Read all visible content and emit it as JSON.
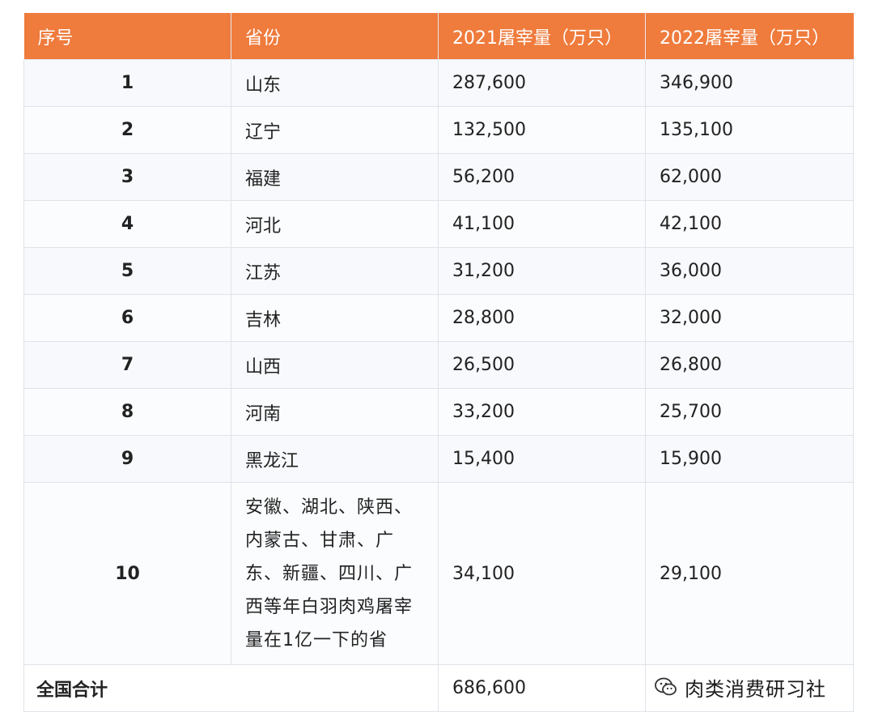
{
  "table": {
    "headers": [
      "序号",
      "省份",
      "2021屠宰量（万只）",
      "2022屠宰量（万只）"
    ],
    "rows": [
      {
        "index": "1",
        "province": "山东",
        "y2021": "287,600",
        "y2022": "346,900"
      },
      {
        "index": "2",
        "province": "辽宁",
        "y2021": "132,500",
        "y2022": "135,100"
      },
      {
        "index": "3",
        "province": "福建",
        "y2021": "56,200",
        "y2022": "62,000"
      },
      {
        "index": "4",
        "province": "河北",
        "y2021": "41,100",
        "y2022": "42,100"
      },
      {
        "index": "5",
        "province": "江苏",
        "y2021": "31,200",
        "y2022": "36,000"
      },
      {
        "index": "6",
        "province": "吉林",
        "y2021": "28,800",
        "y2022": "32,000"
      },
      {
        "index": "7",
        "province": "山西",
        "y2021": "26,500",
        "y2022": "26,800"
      },
      {
        "index": "8",
        "province": "河南",
        "y2021": "33,200",
        "y2022": "25,700"
      },
      {
        "index": "9",
        "province": "黑龙江",
        "y2021": "15,400",
        "y2022": "15,900"
      },
      {
        "index": "10",
        "province_lines": [
          "安徽、湖北、陕西、",
          "内蒙古、甘肃、广",
          "东、新疆、四川、广",
          "西等年白羽肉鸡屠宰",
          "量在1亿一下的省"
        ],
        "y2021": "34,100",
        "y2022": "29,100"
      }
    ],
    "total": {
      "label": "全国合计",
      "y2021": "686,600",
      "y2022": ""
    }
  },
  "watermark": {
    "text": "肉类消费研习社",
    "icon": "wechat-icon"
  },
  "colors": {
    "header_bg": "#ef7b3c",
    "header_text": "#ffffff",
    "row_bg": "#f5f8fc",
    "border": "#dfe3e8"
  }
}
